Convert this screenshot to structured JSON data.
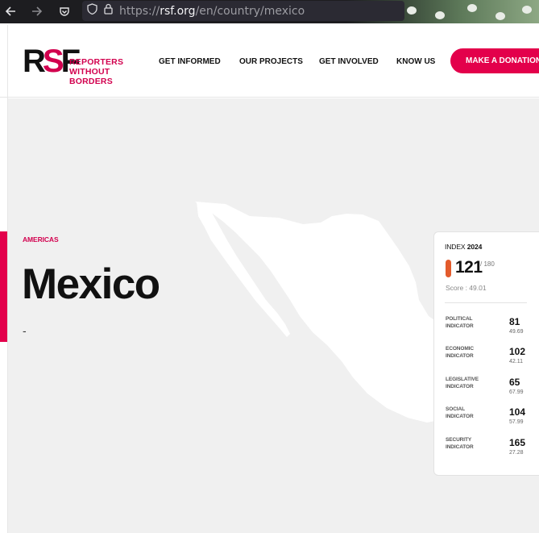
{
  "browser": {
    "url_prefix": "https://",
    "url_domain": "rsf.org",
    "url_path": "/en/country/mexico",
    "back_icon": "arrow-left-icon",
    "forward_icon": "arrow-right-icon",
    "pocket_icon": "pocket-icon",
    "shield_icon": "shield-icon",
    "lock_icon": "lock-icon"
  },
  "header": {
    "logo_mark_r": "R",
    "logo_mark_s": "S",
    "logo_mark_f": "F",
    "logo_line1": "REPORTERS",
    "logo_line2": "WITHOUT BORDERS",
    "nav": [
      {
        "label": "GET INFORMED"
      },
      {
        "label": "OUR PROJECTS"
      },
      {
        "label": "GET INVOLVED"
      },
      {
        "label": "KNOW US"
      }
    ],
    "donate_label": "MAKE A DONATION"
  },
  "country": {
    "region": "AMERICAS",
    "name": "Mexico",
    "dash": "-"
  },
  "index": {
    "title": "INDEX",
    "year": "2024",
    "rank": "121",
    "rank_total": "/ 180",
    "score": "Score : 49.01",
    "rank_color": "#e35b2c",
    "indicators": [
      {
        "line1": "POLITICAL",
        "line2": "INDICATOR",
        "rank": "81",
        "score": "49.69"
      },
      {
        "line1": "ECONOMIC",
        "line2": "INDICATOR",
        "rank": "102",
        "score": "42.11"
      },
      {
        "line1": "LEGISLATIVE",
        "line2": "INDICATOR",
        "rank": "65",
        "score": "67.99"
      },
      {
        "line1": "SOCIAL",
        "line2": "INDICATOR",
        "rank": "104",
        "score": "57.99"
      },
      {
        "line1": "SECURITY",
        "line2": "INDICATOR",
        "rank": "165",
        "score": "27.28"
      }
    ]
  },
  "colors": {
    "accent": "#e3004b",
    "map_fill": "#ffffff",
    "background": "#f0f0f0"
  }
}
